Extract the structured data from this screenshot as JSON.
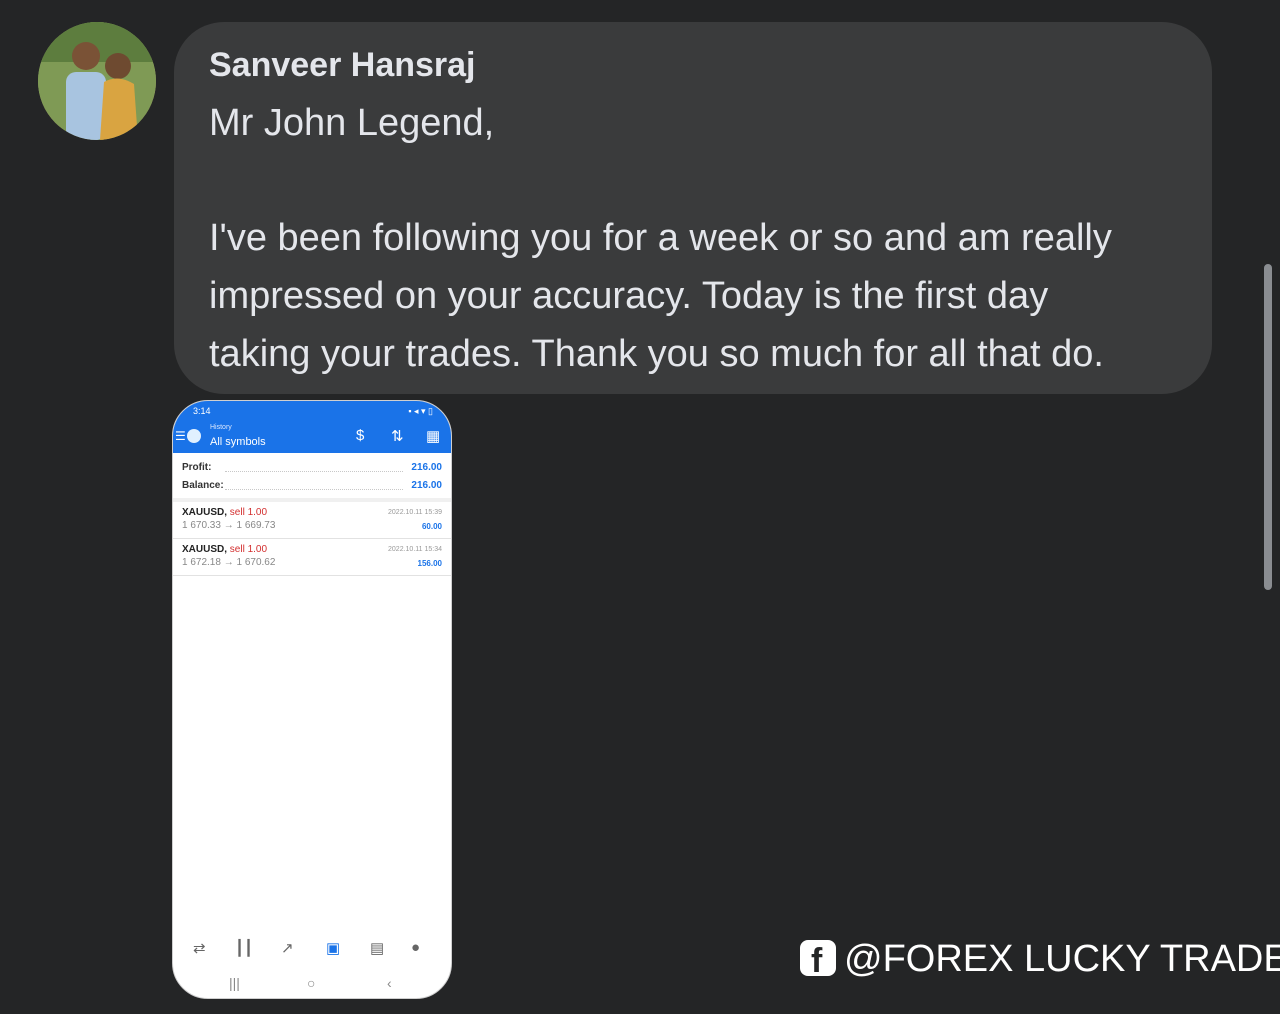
{
  "message": {
    "sender_name": "Sanveer Hansraj",
    "lines": [
      "Mr John Legend,",
      "I've been following you for a week or so and am really",
      "impressed on your accuracy. Today is the first day",
      "taking your trades. Thank you so much for all that do."
    ]
  },
  "attachment": {
    "status_time": "3:14",
    "header_small": "History",
    "header_title": "All symbols",
    "summary": [
      {
        "label": "Profit:",
        "value": "216.00"
      },
      {
        "label": "Balance:",
        "value": "216.00"
      }
    ],
    "trades": [
      {
        "symbol": "XAUUSD,",
        "side": "sell 1.00",
        "prices": "1 670.33 → 1 669.73",
        "datetime": "2022.10.11 15:39",
        "profit": "60.00"
      },
      {
        "symbol": "XAUUSD,",
        "side": "sell 1.00",
        "prices": "1 672.18 → 1 670.62",
        "datetime": "2022.10.11 15:34",
        "profit": "156.00"
      }
    ],
    "nav_icons": [
      "quotes-icon",
      "chart-icon",
      "trade-icon",
      "history-icon",
      "news-icon",
      "chat-icon"
    ],
    "accent_color": "#1a73e8"
  },
  "watermark": {
    "handle": "@FOREX LUCKY TRADER",
    "icon": "facebook-icon"
  },
  "colors": {
    "background": "#242526",
    "bubble": "#3a3b3c",
    "text": "#e4e6eb"
  }
}
